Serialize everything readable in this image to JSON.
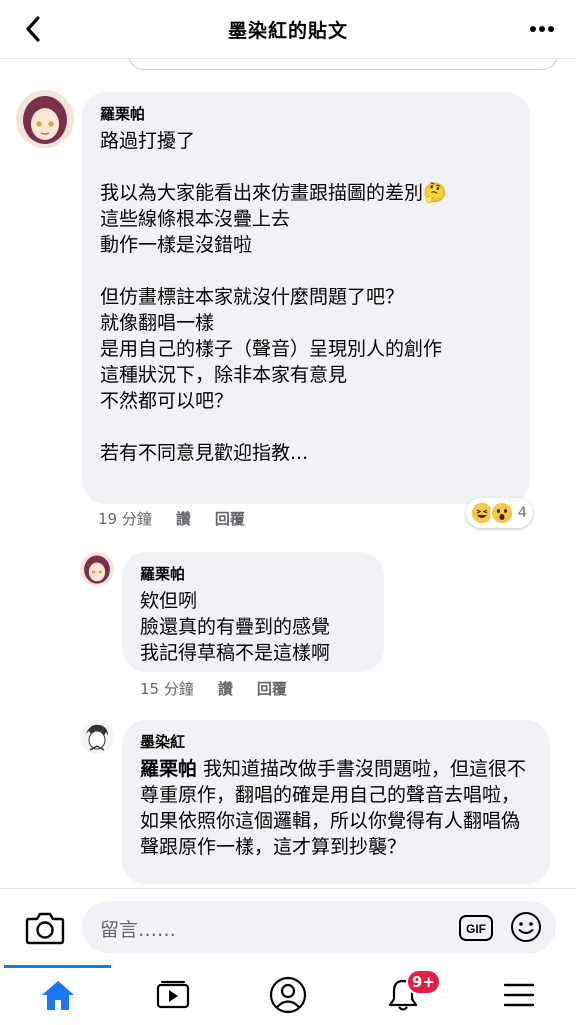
{
  "header": {
    "title": "墨染紅的貼文",
    "back_icon": "chevron-left-icon",
    "more_icon": "more-horizontal-icon"
  },
  "comments": [
    {
      "author": "羅栗帕",
      "text": "路過打擾了\n\n我以為大家能看出來仿畫跟描圖的差別🤔\n這些線條根本沒疊上去\n動作一樣是沒錯啦\n\n但仿畫標註本家就沒什麼問題了吧？\n就像翻唱一樣\n是用自己的樣子（聲音）呈現別人的創作\n這種狀況下，除非本家有意見\n不然都可以吧？\n\n若有不同意見歡迎指教...",
      "time": "19 分鐘",
      "like_label": "讚",
      "reply_label": "回覆",
      "reaction_count": "4"
    },
    {
      "author": "羅栗帕",
      "text": "欸但咧\n臉還真的有疊到的感覺\n我記得草稿不是這樣啊",
      "time": "15 分鐘",
      "like_label": "讚",
      "reply_label": "回覆"
    },
    {
      "author": "墨染紅",
      "mention": "羅栗帕",
      "text": " 我知道描改做手書沒問題啦，但這很不尊重原作，翻唱的確是用自己的聲音去唱啦，如果依照你這個邏輯，所以你覺得有人翻唱偽聲跟原作一樣，這才算到抄襲？"
    }
  ],
  "composer": {
    "placeholder": "留言……",
    "gif_label": "GIF"
  },
  "nav": {
    "notifications_badge": "9+",
    "tabs": [
      "home-icon",
      "video-icon",
      "profile-icon",
      "notifications-icon",
      "menu-icon"
    ]
  },
  "colors": {
    "accent": "#1877f2",
    "bubble": "#f0f2f5",
    "badge": "#e41e3f"
  }
}
